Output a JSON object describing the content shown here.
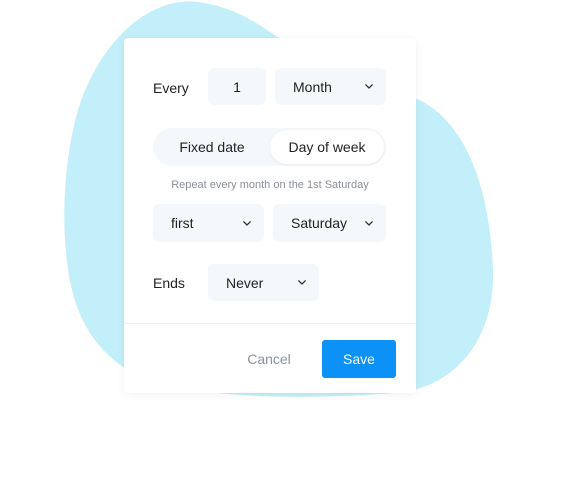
{
  "colors": {
    "blob": "#c2eff9",
    "accent": "#0c91f7",
    "field_bg": "#f5f8fa",
    "hint_text": "#8a8f95"
  },
  "recurrence": {
    "every_label": "Every",
    "interval_value": "1",
    "unit_selected": "Month",
    "mode_tabs": [
      {
        "label": "Fixed date",
        "active": false
      },
      {
        "label": "Day of week",
        "active": true
      }
    ],
    "summary": "Repeat every month on the 1st Saturday",
    "ordinal_selected": "first",
    "weekday_selected": "Saturday",
    "ends_label": "Ends",
    "ends_selected": "Never"
  },
  "actions": {
    "cancel_label": "Cancel",
    "save_label": "Save"
  },
  "icons": {
    "dropdown": "chevron-down-icon"
  }
}
